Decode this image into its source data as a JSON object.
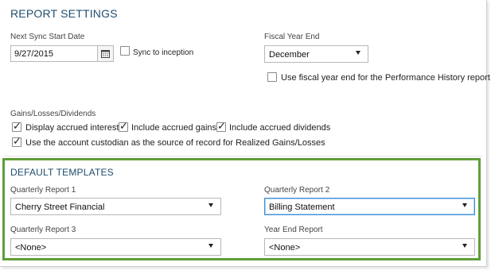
{
  "report_settings": {
    "title": "REPORT SETTINGS",
    "next_sync": {
      "label": "Next Sync Start Date",
      "value": "9/27/2015",
      "sync_to_inception_label": "Sync to inception",
      "sync_to_inception_checked": false
    },
    "fiscal_year_end": {
      "label": "Fiscal Year End",
      "value": "December",
      "use_fiscal_label": "Use fiscal year end for the Performance History report",
      "use_fiscal_checked": false
    },
    "gains": {
      "label": "Gains/Losses/Dividends",
      "options": [
        {
          "label": "Display accrued interest",
          "checked": true
        },
        {
          "label": "Include accrued gains",
          "checked": true
        },
        {
          "label": "Include accrued dividends",
          "checked": true
        },
        {
          "label": "Use the account custodian as the source of record for Realized Gains/Losses",
          "checked": true
        }
      ]
    }
  },
  "default_templates": {
    "title": "DEFAULT TEMPLATES",
    "quarterly_report_1": {
      "label": "Quarterly Report 1",
      "value": "Cherry Street Financial"
    },
    "quarterly_report_2": {
      "label": "Quarterly Report 2",
      "value": "Billing Statement"
    },
    "quarterly_report_3": {
      "label": "Quarterly Report 3",
      "value": "<None>"
    },
    "year_end_report": {
      "label": "Year End Report",
      "value": "<None>"
    },
    "highlight_color": "#5f9e3b"
  },
  "icons": {
    "calendar": "calendar-icon",
    "dropdown": "chevron-down-icon",
    "check": "check-icon"
  }
}
